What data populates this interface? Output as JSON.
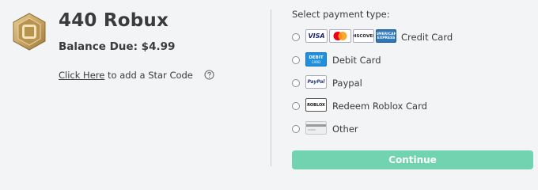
{
  "product": {
    "title": "440 Robux",
    "balance_due": "Balance Due: $4.99",
    "icon": "robux-icon",
    "icon_color": "#c9a664"
  },
  "starcode": {
    "link_text": "Click Here",
    "rest_text": " to add a Star Code",
    "help_icon": "question-circle-icon"
  },
  "payment": {
    "title": "Select payment type:",
    "options": [
      {
        "label": "Credit Card",
        "logos": [
          "VISA",
          "MasterCard",
          "DISCOVER",
          "AMERICAN EXPRESS"
        ]
      },
      {
        "label": "Debit Card",
        "logos": [
          "DEBIT",
          "CARD"
        ]
      },
      {
        "label": "Paypal",
        "logos": [
          "PayPal"
        ]
      },
      {
        "label": "Redeem Roblox Card",
        "logos": [
          "ROBLOX"
        ]
      },
      {
        "label": "Other",
        "logos": []
      }
    ]
  },
  "actions": {
    "continue_label": "Continue",
    "continue_color": "#72d3b0"
  }
}
